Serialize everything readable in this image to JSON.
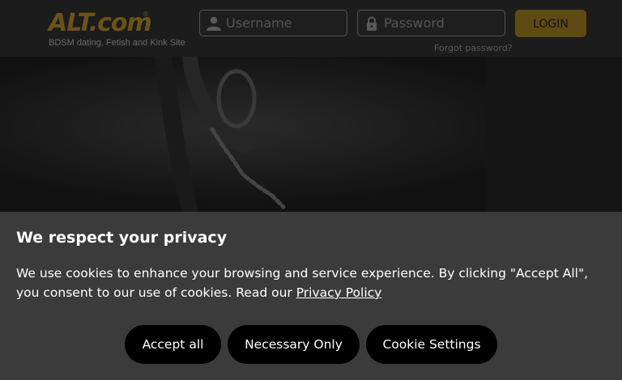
{
  "header": {
    "logo": "ALT.com",
    "logo_reg": "®",
    "tagline": "BDSM dating, Fetish and Kink Site",
    "username_placeholder": "Username",
    "password_placeholder": "Password",
    "login_label": "LOGIN",
    "forgot_label": "Forgot password?"
  },
  "icons": {
    "user": "user-icon",
    "lock": "lock-icon",
    "hero": "handcuffs-photo"
  },
  "cookie_banner": {
    "title": "We respect your privacy",
    "text": "We use cookies to enhance your browsing and service experience. By clicking \"Accept All\", you consent to our use of cookies. Read our ",
    "policy_link": "Privacy Policy",
    "buttons": {
      "accept_all": "Accept all",
      "necessary_only": "Necessary Only",
      "cookie_settings": "Cookie Settings"
    }
  },
  "colors": {
    "brand_gold": "#6b5318",
    "login_button": "#5e4a12",
    "banner_bg": "#3b3b3b",
    "button_bg": "#000000"
  }
}
